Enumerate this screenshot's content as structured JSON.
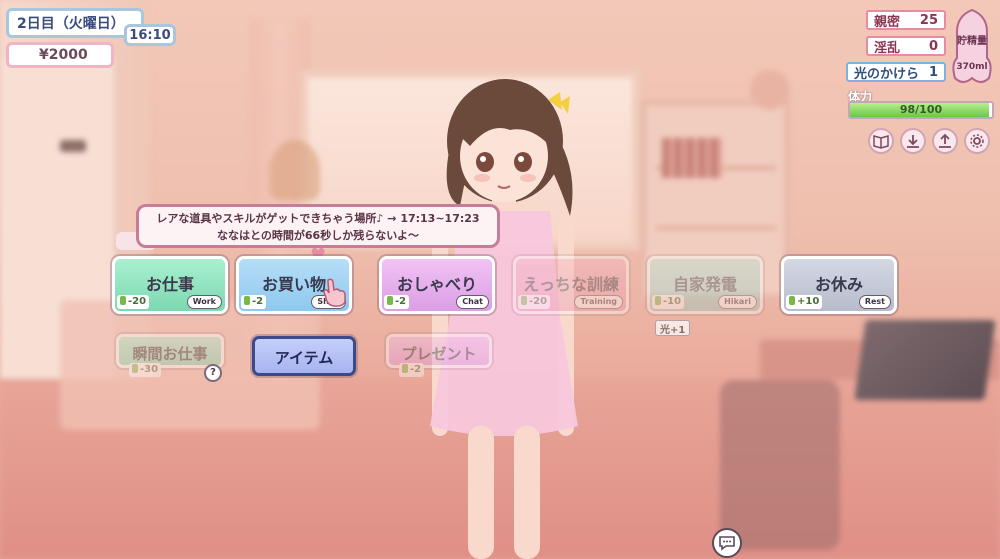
{
  "hud": {
    "day": "2日目（火曜日）",
    "time": "16:10",
    "money": "¥2000"
  },
  "stats": [
    {
      "label": "親密",
      "value": "25"
    },
    {
      "label": "淫乱",
      "value": "0"
    },
    {
      "label": "光のかけら",
      "value": "1"
    }
  ],
  "gauge": {
    "label": "貯精量",
    "value": "370ml"
  },
  "hp": {
    "label": "体力",
    "text": "98/100",
    "fraction": 0.98
  },
  "toolbar": [
    "book-icon",
    "download-icon",
    "upload-icon",
    "gear-icon"
  ],
  "bubble": {
    "line1": "レアな道具やスキルがゲットできちゃう場所♪ → 17:13~17:23",
    "line2": "ななはとの時間が66秒しか残らないよ～"
  },
  "actions": [
    {
      "label": "お仕事",
      "cost": "-20",
      "tag": "Work"
    },
    {
      "label": "お買い物",
      "cost": "-2",
      "tag": "Shop"
    },
    {
      "label": "おしゃべり",
      "cost": "-2",
      "tag": "Chat"
    },
    {
      "label": "えっちな訓練",
      "cost": "-20",
      "tag": "Training"
    },
    {
      "label": "自家発電",
      "cost": "-10",
      "tag": "Hikari",
      "extra": "光+1"
    },
    {
      "label": "お休み",
      "cost": "+10",
      "tag": "Rest"
    }
  ],
  "sub_actions": [
    {
      "label": "瞬間お仕事",
      "cost": "-30",
      "help": "?"
    },
    {
      "label": "アイテム"
    },
    {
      "label": "プレゼント",
      "cost": "-2"
    }
  ],
  "colors": {
    "accent": "#e88aa4",
    "hp": "#6cc64a"
  }
}
